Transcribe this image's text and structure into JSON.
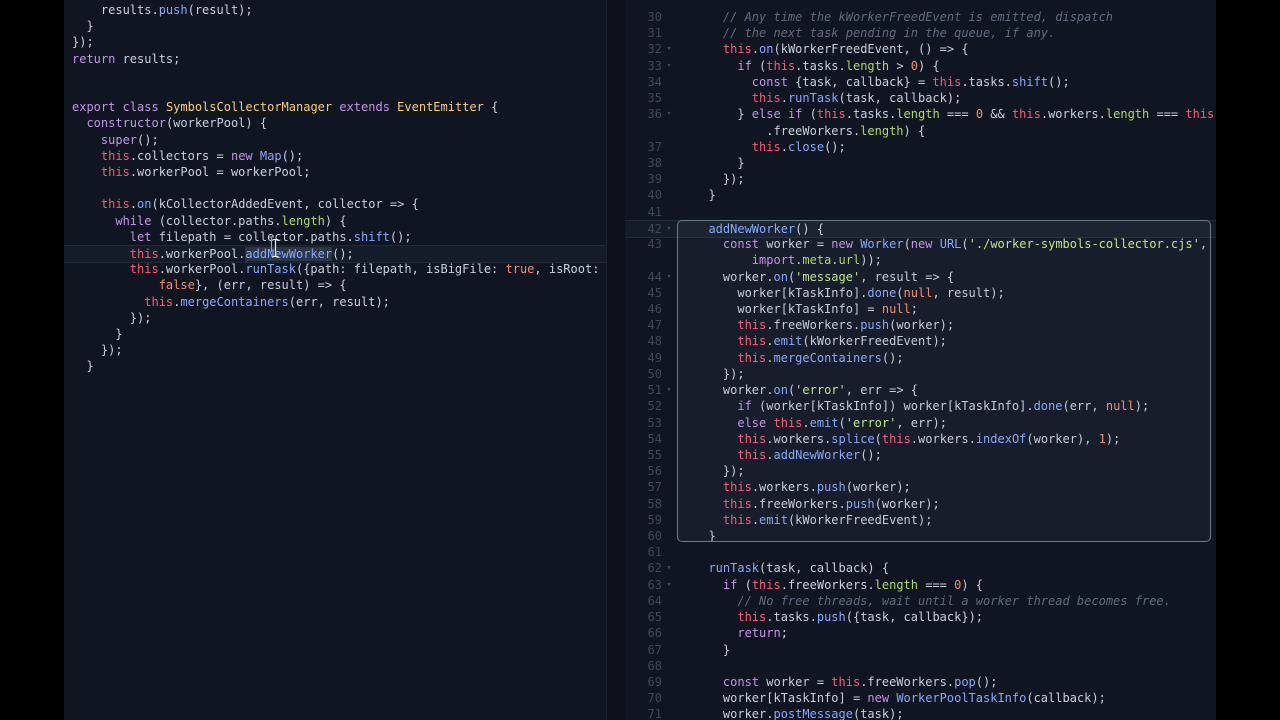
{
  "left_code": [
    "    results.push(result);",
    "  }",
    "});",
    "return results;",
    "",
    "",
    "export class SymbolsCollectorManager extends EventEmitter {",
    "  constructor(workerPool) {",
    "    super();",
    "    this.collectors = new Map();",
    "    this.workerPool = workerPool;",
    "",
    "    this.on(kCollectorAddedEvent, collector => {",
    "      while (collector.paths.length) {",
    "        let filepath = collector.paths.shift();",
    "        this.workerPool.addNewWorker();",
    "        this.workerPool.runTask({path: filepath, isBigFile: true, isRoot:",
    "            false}, (err, result) => {",
    "          this.mergeContainers(err, result);",
    "        });",
    "      }",
    "    });",
    "  }"
  ],
  "right_lines": [
    {
      "num": "30",
      "code": "    // Any time the kWorkerFreedEvent is emitted, dispatch"
    },
    {
      "num": "31",
      "code": "    // the next task pending in the queue, if any."
    },
    {
      "num": "32",
      "code": "    this.on(kWorkerFreedEvent, () => {"
    },
    {
      "num": "33",
      "code": "      if (this.tasks.length > 0) {"
    },
    {
      "num": "34",
      "code": "        const {task, callback} = this.tasks.shift();"
    },
    {
      "num": "35",
      "code": "        this.runTask(task, callback);"
    },
    {
      "num": "36",
      "code": "      } else if (this.tasks.length === 0 && this.workers.length === this"
    },
    {
      "num": "",
      "code": "          .freeWorkers.length) {"
    },
    {
      "num": "37",
      "code": "        this.close();"
    },
    {
      "num": "38",
      "code": "      }"
    },
    {
      "num": "39",
      "code": "    });"
    },
    {
      "num": "40",
      "code": "  }"
    },
    {
      "num": "41",
      "code": ""
    },
    {
      "num": "42",
      "code": "  addNewWorker() {"
    },
    {
      "num": "43",
      "code": "    const worker = new Worker(new URL('./worker-symbols-collector.cjs',"
    },
    {
      "num": "",
      "code": "        import.meta.url));"
    },
    {
      "num": "44",
      "code": "    worker.on('message', result => {"
    },
    {
      "num": "45",
      "code": "      worker[kTaskInfo].done(null, result);"
    },
    {
      "num": "46",
      "code": "      worker[kTaskInfo] = null;"
    },
    {
      "num": "47",
      "code": "      this.freeWorkers.push(worker);"
    },
    {
      "num": "48",
      "code": "      this.emit(kWorkerFreedEvent);"
    },
    {
      "num": "49",
      "code": "      this.mergeContainers();"
    },
    {
      "num": "50",
      "code": "    });"
    },
    {
      "num": "51",
      "code": "    worker.on('error', err => {"
    },
    {
      "num": "52",
      "code": "      if (worker[kTaskInfo]) worker[kTaskInfo].done(err, null);"
    },
    {
      "num": "53",
      "code": "      else this.emit('error', err);"
    },
    {
      "num": "54",
      "code": "      this.workers.splice(this.workers.indexOf(worker), 1);"
    },
    {
      "num": "55",
      "code": "      this.addNewWorker();"
    },
    {
      "num": "56",
      "code": "    });"
    },
    {
      "num": "57",
      "code": "    this.workers.push(worker);"
    },
    {
      "num": "58",
      "code": "    this.freeWorkers.push(worker);"
    },
    {
      "num": "59",
      "code": "    this.emit(kWorkerFreedEvent);"
    },
    {
      "num": "60",
      "code": "  }"
    },
    {
      "num": "61",
      "code": ""
    },
    {
      "num": "62",
      "code": "  runTask(task, callback) {"
    },
    {
      "num": "63",
      "code": "    if (this.freeWorkers.length === 0) {"
    },
    {
      "num": "64",
      "code": "      // No free threads, wait until a worker thread becomes free."
    },
    {
      "num": "65",
      "code": "      this.tasks.push({task, callback});"
    },
    {
      "num": "66",
      "code": "      return;"
    },
    {
      "num": "67",
      "code": "    }"
    },
    {
      "num": "68",
      "code": ""
    },
    {
      "num": "69",
      "code": "    const worker = this.freeWorkers.pop();"
    },
    {
      "num": "70",
      "code": "    worker[kTaskInfo] = new WorkerPoolTaskInfo(callback);"
    },
    {
      "num": "71",
      "code": "    worker.postMessage(task);"
    }
  ],
  "fold_markers": [
    "32",
    "33",
    "36",
    "42",
    "44",
    "51",
    "62",
    "63"
  ],
  "selected_text": "addNewWorker",
  "colors": {
    "background": "#0f1521",
    "keyword": "#c792ea",
    "this": "#ff5874",
    "function": "#82aaff",
    "string": "#c3e88d",
    "number": "#f78c6c",
    "property": "#addb67",
    "comment": "#5f6b7e"
  }
}
